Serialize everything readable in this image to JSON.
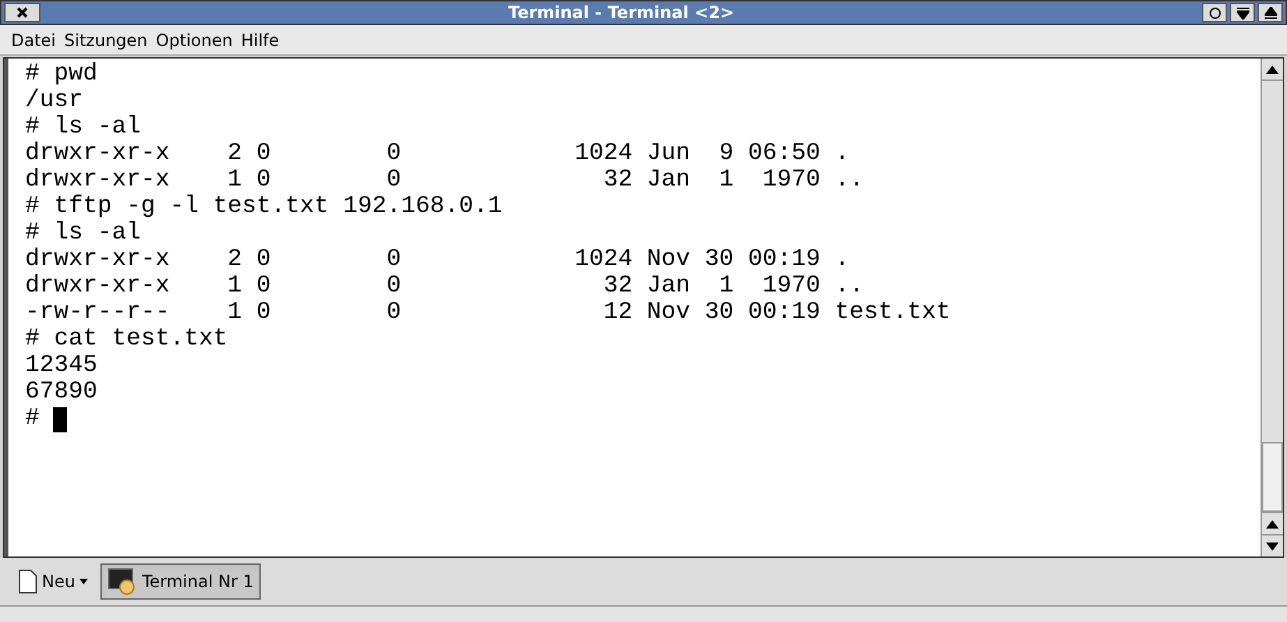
{
  "window": {
    "title": "Terminal - Terminal <2>"
  },
  "menu": [
    "Datei",
    "Sitzungen",
    "Optionen",
    "Hilfe"
  ],
  "terminal": {
    "lines": [
      "# pwd",
      "/usr",
      "# ls -al",
      "drwxr-xr-x    2 0        0            1024 Jun  9 06:50 .",
      "drwxr-xr-x    1 0        0              32 Jan  1  1970 ..",
      "# tftp -g -l test.txt 192.168.0.1",
      "# ls -al",
      "drwxr-xr-x    2 0        0            1024 Nov 30 00:19 .",
      "drwxr-xr-x    1 0        0              32 Jan  1  1970 ..",
      "-rw-r--r--    1 0        0              12 Nov 30 00:19 test.txt",
      "# cat test.txt",
      "12345",
      "67890",
      "#"
    ]
  },
  "tabs": [
    {
      "kind": "new",
      "label": "Neu",
      "selected": false
    },
    {
      "kind": "session",
      "label": "Terminal Nr 1",
      "selected": true
    }
  ]
}
